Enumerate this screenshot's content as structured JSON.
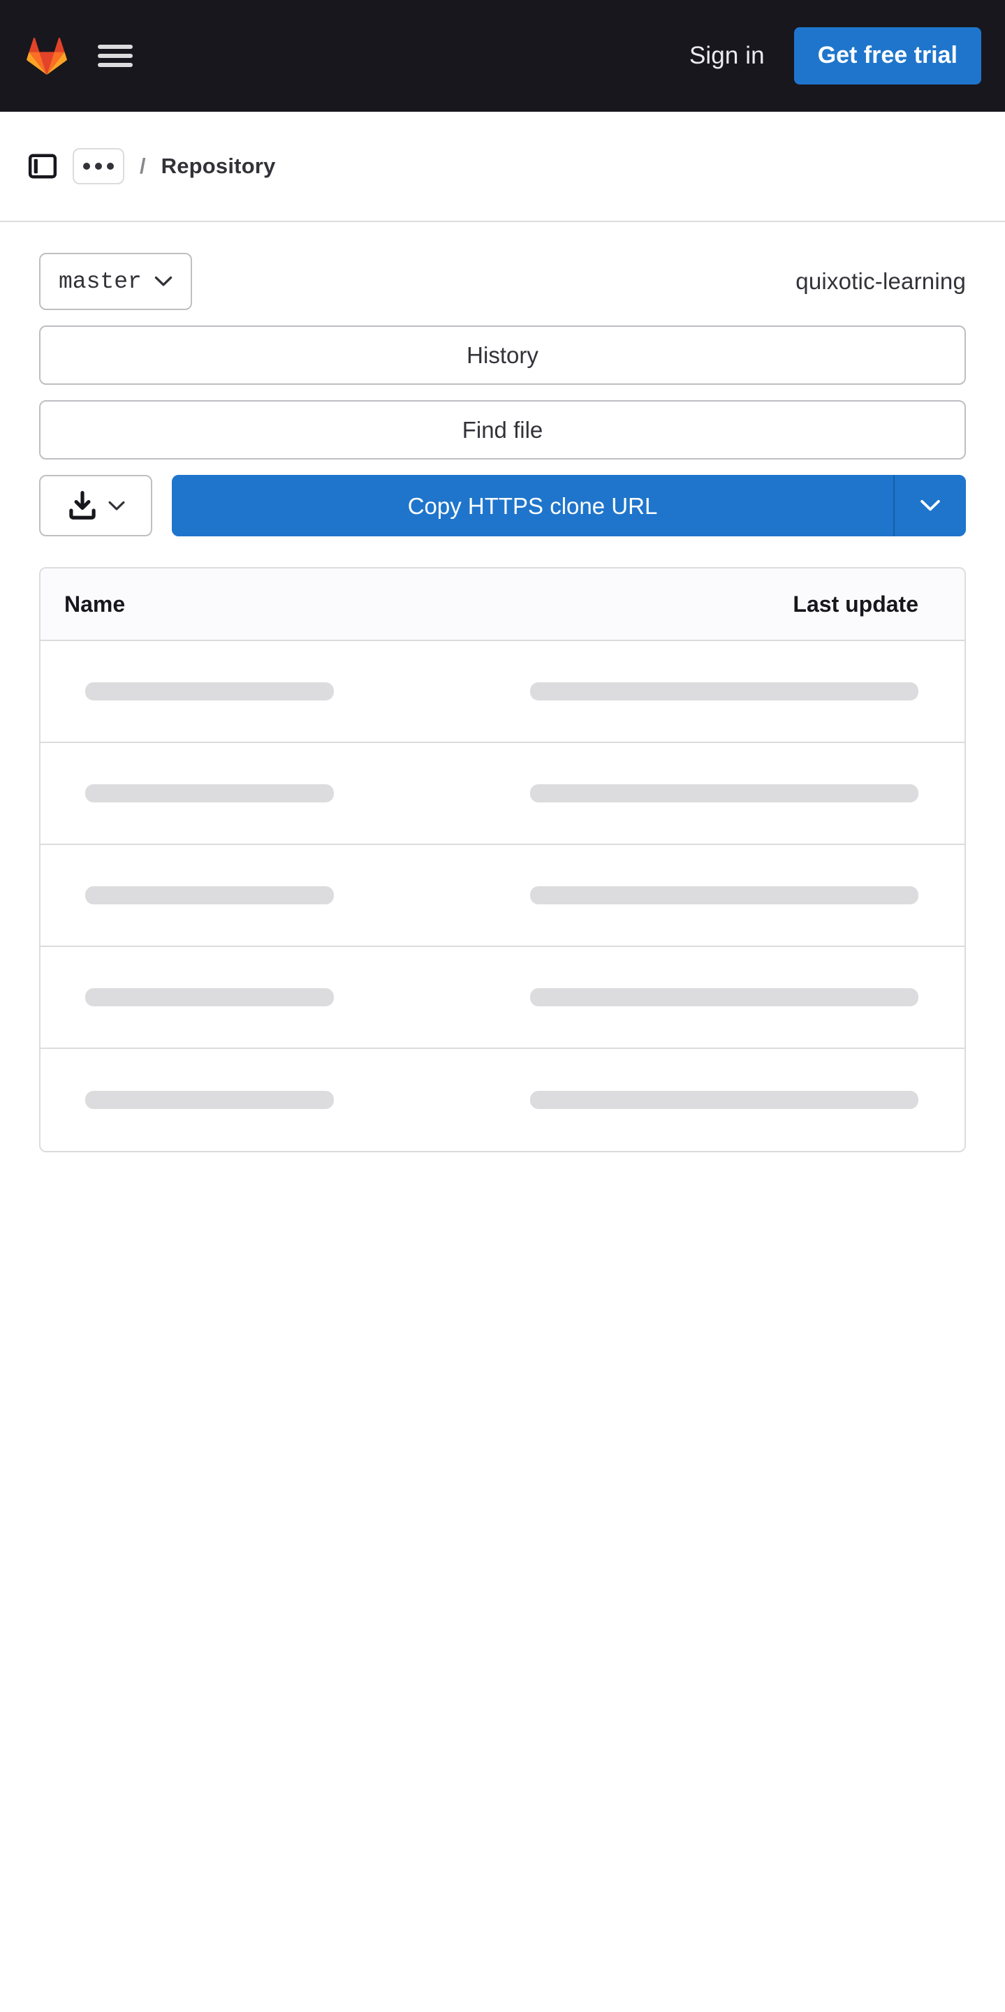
{
  "navbar": {
    "logo_icon": "gitlab-tanuki-logo",
    "menu_icon": "hamburger-menu-icon",
    "sign_in_label": "Sign in",
    "trial_label": "Get free trial",
    "background_color": "#18171d",
    "accent_color": "#1f75cb"
  },
  "breadcrumb": {
    "sidebar_toggle_icon": "sidebar-panel-icon",
    "overflow_icon": "ellipsis-horizontal-icon",
    "separator": "/",
    "current": "Repository"
  },
  "repo_header": {
    "branch": "master",
    "branch_caret_icon": "chevron-down-icon",
    "repo_name": "quixotic-learning"
  },
  "actions": {
    "history_label": "History",
    "find_file_label": "Find file",
    "download_icon": "download-icon",
    "download_caret_icon": "chevron-down-icon",
    "clone_label": "Copy HTTPS clone URL",
    "clone_caret_icon": "chevron-down-icon"
  },
  "file_table": {
    "columns": [
      "Name",
      "Last update"
    ],
    "rows": [
      {
        "name": "",
        "last_update": "",
        "loading": true
      },
      {
        "name": "",
        "last_update": "",
        "loading": true
      },
      {
        "name": "",
        "last_update": "",
        "loading": true
      },
      {
        "name": "",
        "last_update": "",
        "loading": true
      },
      {
        "name": "",
        "last_update": "",
        "loading": true
      }
    ]
  }
}
